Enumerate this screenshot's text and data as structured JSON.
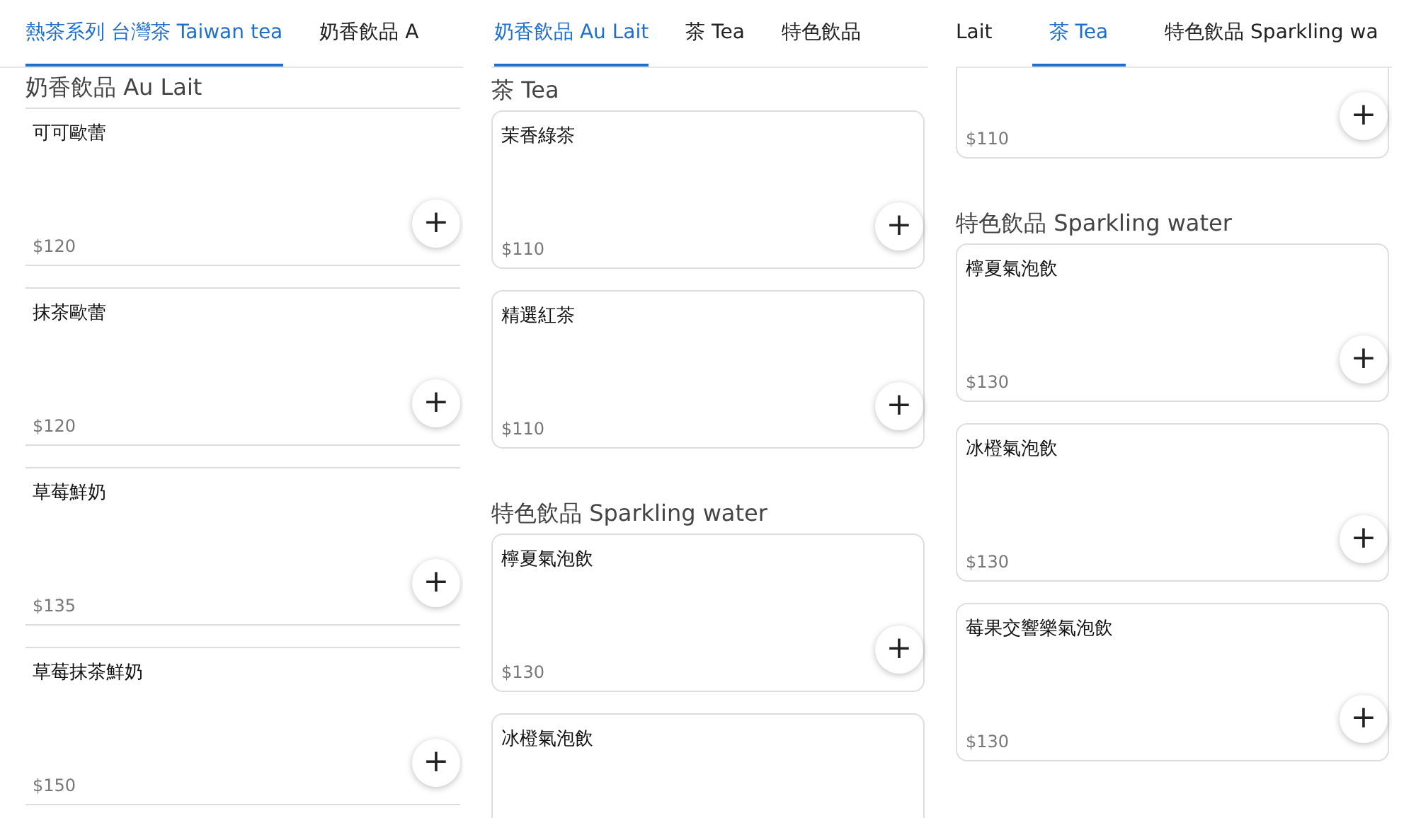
{
  "panels": [
    {
      "tabs": [
        {
          "label": "熱茶系列 台灣茶 Taiwan tea",
          "selected": true
        },
        {
          "label": "奶香飲品 A",
          "selected": false
        }
      ],
      "sections": [
        {
          "heading": "奶香飲品 Au Lait",
          "items": [
            {
              "name": "可可歐蕾",
              "price": "$120",
              "add": "+"
            },
            {
              "name": "抹茶歐蕾",
              "price": "$120",
              "add": "+"
            },
            {
              "name": "草莓鮮奶",
              "price": "$135",
              "add": "+"
            },
            {
              "name": "草莓抹茶鮮奶",
              "price": "$150",
              "add": "+"
            }
          ]
        }
      ]
    },
    {
      "tabs": [
        {
          "label": "奶香飲品 Au Lait",
          "selected": true
        },
        {
          "label": "茶 Tea",
          "selected": false
        },
        {
          "label": "特色飲品",
          "selected": false
        }
      ],
      "sections": [
        {
          "heading": "茶 Tea",
          "items": [
            {
              "name": "茉香綠茶",
              "price": "$110",
              "add": "+"
            },
            {
              "name": "精選紅茶",
              "price": "$110",
              "add": "+"
            }
          ]
        },
        {
          "heading": "特色飲品 Sparkling water",
          "items": [
            {
              "name": "檸夏氣泡飲",
              "price": "$130",
              "add": "+"
            },
            {
              "name": "冰橙氣泡飲"
            }
          ]
        }
      ]
    },
    {
      "tabs": [
        {
          "label": "Lait",
          "selected": false
        },
        {
          "label": "茶 Tea",
          "selected": true
        },
        {
          "label": "特色飲品 Sparkling wa",
          "selected": false
        }
      ],
      "sections": [
        {
          "items": [
            {
              "price": "$110",
              "add": "+"
            }
          ]
        },
        {
          "heading": "特色飲品 Sparkling water",
          "items": [
            {
              "name": "檸夏氣泡飲",
              "price": "$130",
              "add": "+"
            },
            {
              "name": "冰橙氣泡飲",
              "price": "$130",
              "add": "+"
            },
            {
              "name": "莓果交響樂氣泡飲",
              "price": "$130",
              "add": "+"
            }
          ]
        }
      ]
    }
  ]
}
